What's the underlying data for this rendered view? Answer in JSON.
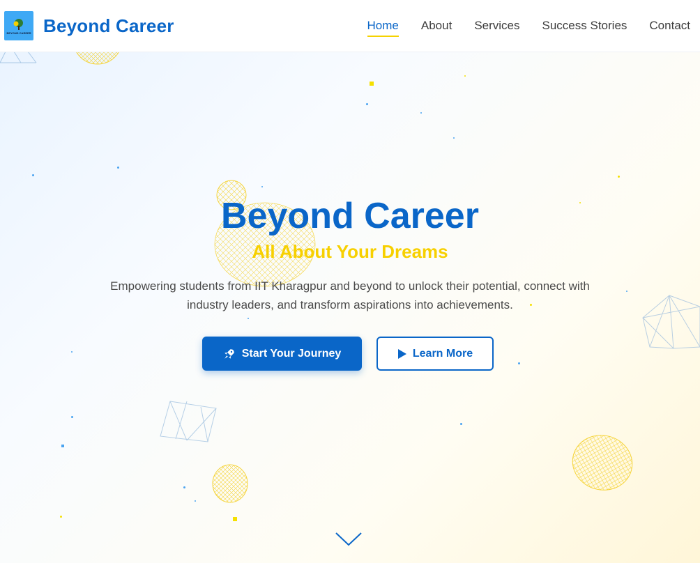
{
  "header": {
    "brand": "Beyond Career",
    "logo_text": "BEYOND CAREER",
    "nav": [
      {
        "label": "Home",
        "active": true
      },
      {
        "label": "About",
        "active": false
      },
      {
        "label": "Services",
        "active": false
      },
      {
        "label": "Success Stories",
        "active": false
      },
      {
        "label": "Contact",
        "active": false
      }
    ]
  },
  "hero": {
    "title": "Beyond Career",
    "subtitle": "All About Your Dreams",
    "description": "Empowering students from IIT Kharagpur and beyond to unlock their potential, connect with industry leaders, and transform aspirations into achievements.",
    "primary_button": {
      "label": "Start Your Journey",
      "icon": "rocket-icon"
    },
    "secondary_button": {
      "label": "Learn More",
      "icon": "play-icon"
    },
    "scroll_icon": "chevron-down-icon"
  },
  "colors": {
    "primary": "#0a66c8",
    "accent": "#f7d000",
    "text": "#4a4a4a"
  }
}
